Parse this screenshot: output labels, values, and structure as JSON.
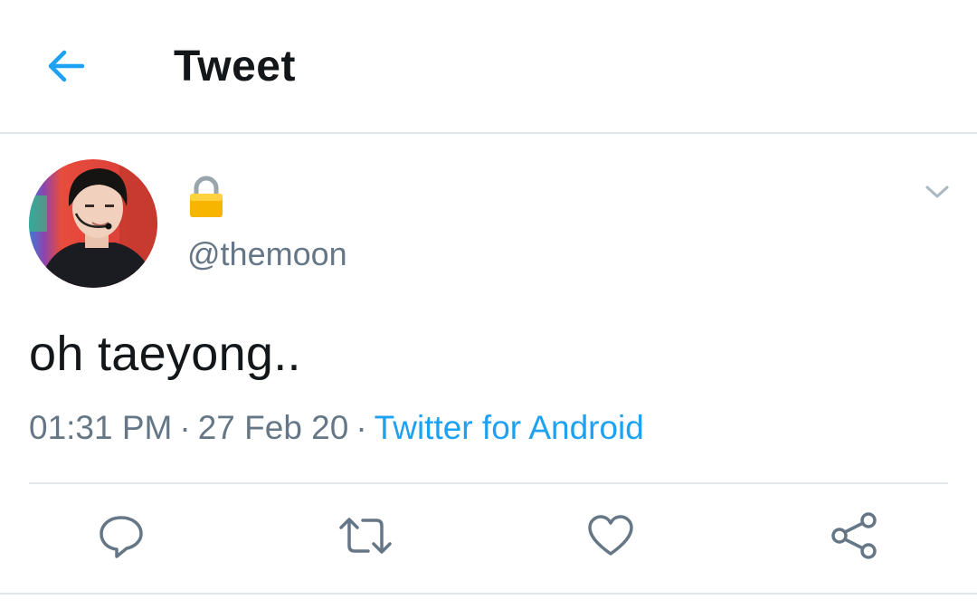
{
  "header": {
    "back_icon": "arrow-left-icon",
    "title": "Tweet",
    "accent_color": "#1da1f2"
  },
  "tweet": {
    "display_name_icon": "lock-icon",
    "handle": "@themoon",
    "text": "oh taeyong..",
    "time": "01:31 PM",
    "date": "27 Feb 20",
    "separator": "·",
    "source": "Twitter for Android",
    "caret_icon": "chevron-down-icon"
  },
  "actions": [
    {
      "name": "reply",
      "icon": "reply-icon"
    },
    {
      "name": "retweet",
      "icon": "retweet-icon"
    },
    {
      "name": "like",
      "icon": "heart-icon"
    },
    {
      "name": "share",
      "icon": "share-icon"
    }
  ],
  "colors": {
    "text": "#14171a",
    "secondary": "#657786",
    "divider": "#e1e8ed",
    "link": "#1da1f2"
  }
}
